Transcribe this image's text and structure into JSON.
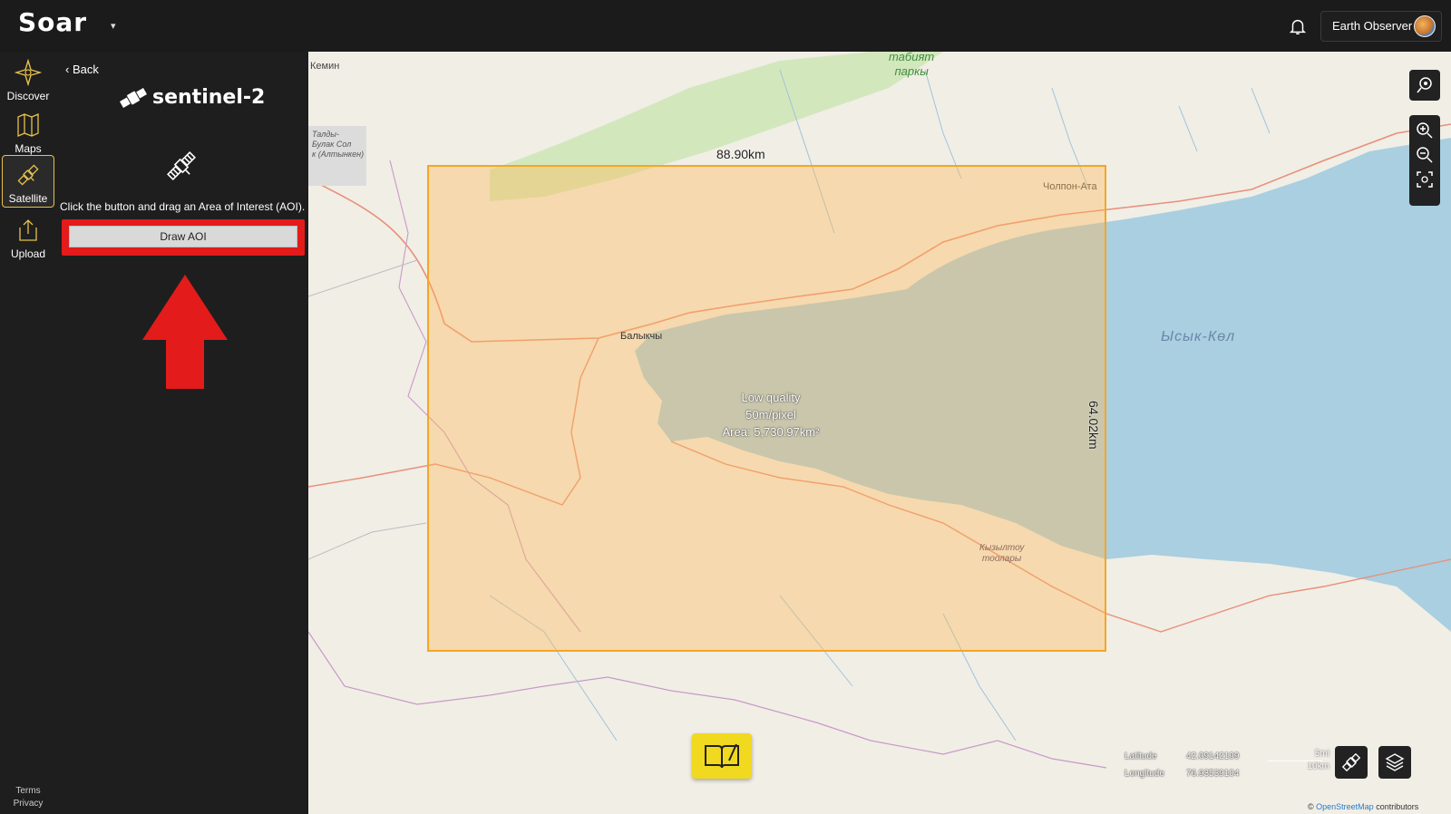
{
  "header": {
    "logo": "Soar",
    "logo_caret": "▾",
    "user_name": "Earth Observer"
  },
  "nav": {
    "items": [
      {
        "label": "Discover",
        "icon": "compass-star-icon"
      },
      {
        "label": "Maps",
        "icon": "map-icon"
      },
      {
        "label": "Satellite",
        "icon": "satellite-icon",
        "active": true
      },
      {
        "label": "Upload",
        "icon": "upload-icon"
      }
    ],
    "terms": "Terms",
    "privacy": "Privacy"
  },
  "panel": {
    "back": "Back",
    "title": "sentinel-2",
    "instructions": "Click the button and drag an Area of Interest (AOI).",
    "draw_button": "Draw AOI"
  },
  "map": {
    "aoi": {
      "width_label": "88.90km",
      "height_label": "64.02km",
      "quality": "Low quality",
      "resolution": "50m/pixel",
      "area": "Area: 5,730.97km²"
    },
    "labels": {
      "kemin": "Кемин",
      "balykchy": "Балыкчы",
      "cholpon_ata": "Чолпон-Ата",
      "lake": "Ысык-Көл",
      "park_line1": "табият",
      "park_line2": "паркы",
      "mountains_line1": "Кызылтоу",
      "mountains_line2": "тоолары",
      "talda_line1": "Талды-",
      "talda_line2": "Булак Сол",
      "talda_line3": "к (Алтынкен)"
    },
    "coords": {
      "latitude_label": "Latitude",
      "latitude_value": "42.09142199",
      "longitude_label": "Longitude",
      "longitude_value": "76.93539104"
    },
    "scale": {
      "miles": "5mi",
      "km": "10km"
    },
    "attribution_prefix": "© ",
    "attribution_link": "OpenStreetMap",
    "attribution_suffix": " contributors"
  },
  "colors": {
    "aoi_border": "#f5a623",
    "highlight_red": "#e31b1b",
    "accent_yellow": "#f1d91f",
    "lake": "#a9cfe0"
  }
}
